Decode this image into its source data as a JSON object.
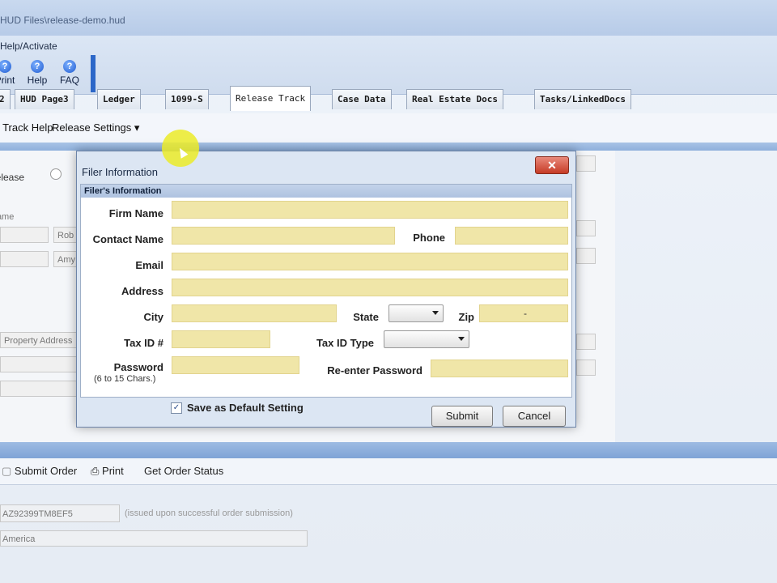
{
  "window": {
    "title": "HUD Files\\release-demo.hud"
  },
  "ribbon": {
    "menu_label": "Help/Activate",
    "buttons": [
      {
        "label": "Print",
        "icon": "print-icon"
      },
      {
        "label": "Help",
        "icon": "help-icon"
      },
      {
        "label": "FAQ",
        "icon": "faq-icon"
      }
    ]
  },
  "tabs": [
    {
      "label": "2"
    },
    {
      "label": "HUD Page3"
    },
    {
      "label": "Ledger"
    },
    {
      "label": "1099-S"
    },
    {
      "label": "Release Track"
    },
    {
      "label": "Case Data"
    },
    {
      "label": "Real Estate Docs"
    },
    {
      "label": "Tasks/LinkedDocs"
    }
  ],
  "subtoolbar": {
    "help": "Release Track Help",
    "settings": "Release Settings"
  },
  "background": {
    "radio_label": "Release",
    "name_label": "Name",
    "field_1": "Rob",
    "field_2": "Amy",
    "property_address": "Property Address"
  },
  "bottom_toolbar": {
    "submit": "Submit Order",
    "print": "Print",
    "status": "Get Order Status"
  },
  "order": {
    "id": "AZ92399TM8EF5",
    "note": "(issued upon successful order submission)",
    "region": "America"
  },
  "dialog": {
    "title": "Filer Information",
    "section": "Filer's Information",
    "labels": {
      "firm_name": "Firm Name",
      "contact_name": "Contact Name",
      "phone": "Phone",
      "email": "Email",
      "address": "Address",
      "city": "City",
      "state": "State",
      "zip": "Zip",
      "tax_id": "Tax ID #",
      "tax_id_type": "Tax ID Type",
      "password": "Password",
      "password_hint": "(6 to 15 Chars.)",
      "reenter_password": "Re-enter Password"
    },
    "values": {
      "firm_name": "",
      "contact_name": "",
      "phone": "",
      "email": "",
      "address": "",
      "city": "",
      "state": "",
      "zip": "-",
      "tax_id": "",
      "tax_id_type": "",
      "password": "",
      "reenter_password": ""
    },
    "save_default_label": "Save as Default Setting",
    "save_default_checked": true,
    "submit_label": "Submit",
    "cancel_label": "Cancel",
    "close_glyph": "✕"
  }
}
